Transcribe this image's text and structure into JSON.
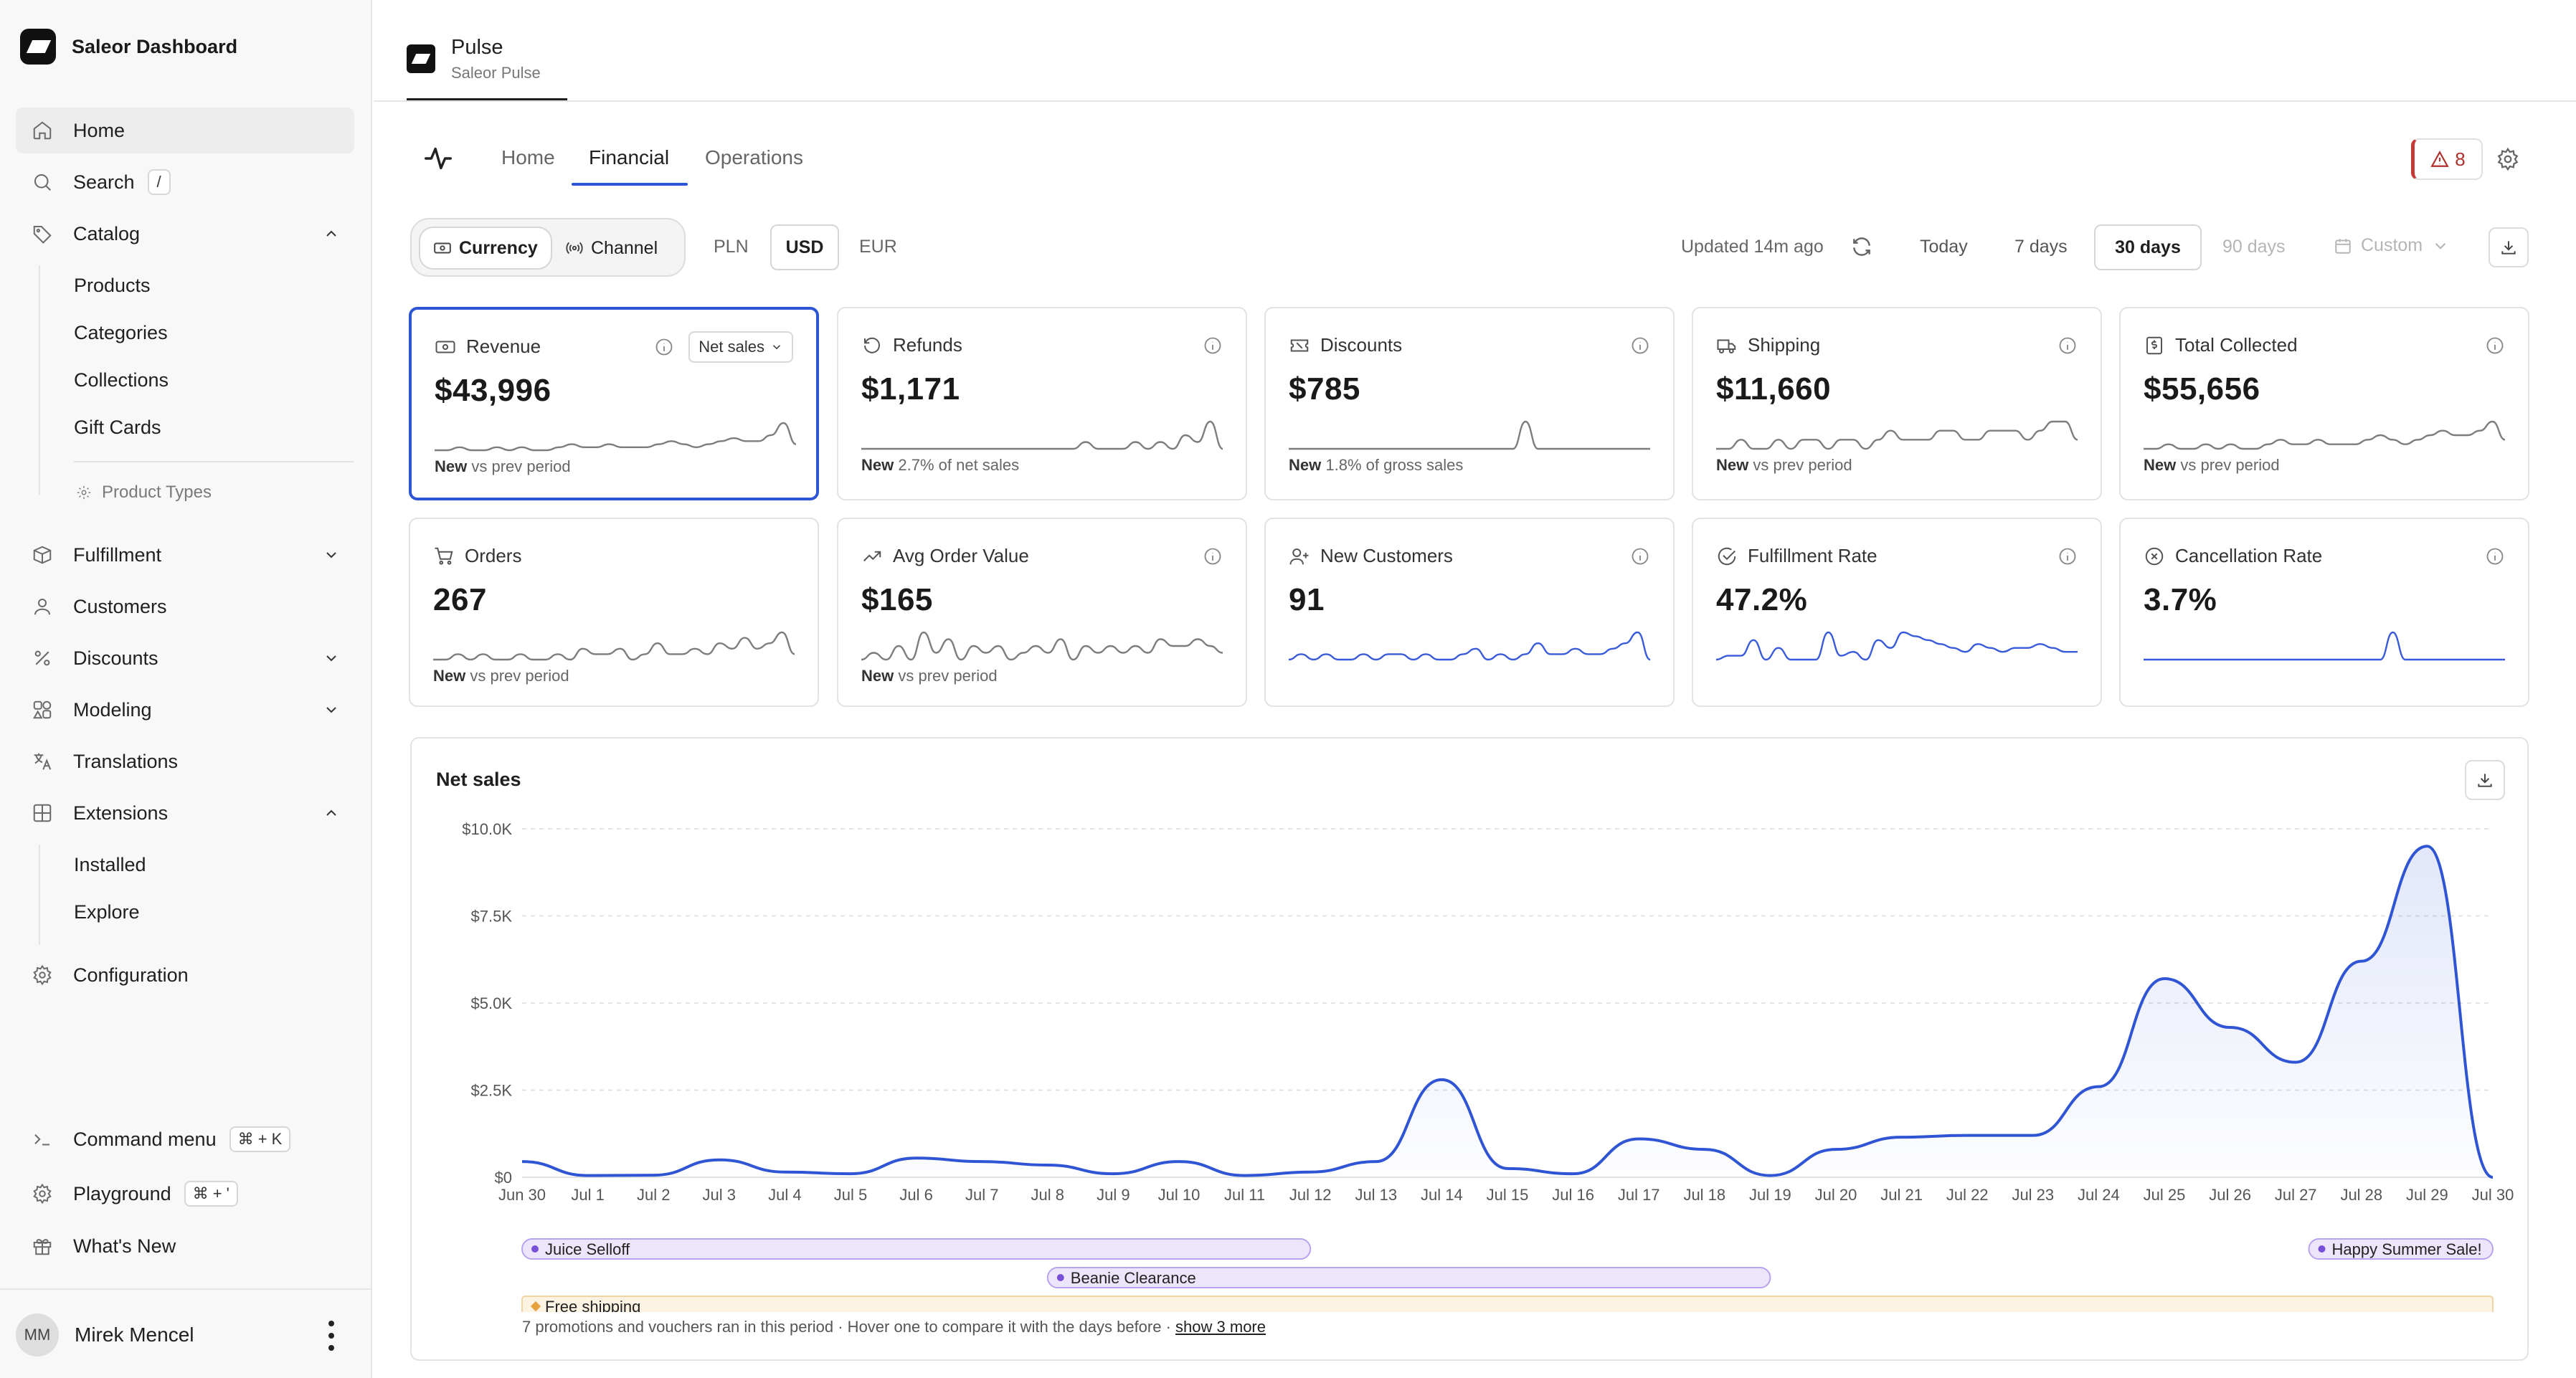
{
  "sidebar": {
    "brand": "Saleor Dashboard",
    "items": [
      {
        "label": "Home"
      },
      {
        "label": "Search",
        "shortcut": "/"
      },
      {
        "label": "Catalog"
      },
      {
        "label": "Fulfillment"
      },
      {
        "label": "Customers"
      },
      {
        "label": "Discounts"
      },
      {
        "label": "Modeling"
      },
      {
        "label": "Translations"
      },
      {
        "label": "Extensions"
      },
      {
        "label": "Configuration"
      }
    ],
    "catalog_sub": [
      "Products",
      "Categories",
      "Collections",
      "Gift Cards"
    ],
    "catalog_muted": "Product Types",
    "extensions_sub": [
      "Installed",
      "Explore"
    ],
    "bottom": [
      {
        "label": "Command menu",
        "shortcut": "⌘ + K"
      },
      {
        "label": "Playground",
        "shortcut": "⌘ + '"
      },
      {
        "label": "What's New"
      }
    ],
    "user": {
      "initials": "MM",
      "name": "Mirek Mencel"
    }
  },
  "app": {
    "title": "Pulse",
    "subtitle": "Saleor Pulse"
  },
  "tabs": [
    "Home",
    "Financial",
    "Operations"
  ],
  "alerts": {
    "count": "8"
  },
  "filters": {
    "group_by": [
      "Currency",
      "Channel"
    ],
    "currencies": [
      "PLN",
      "USD",
      "EUR"
    ],
    "updated": "Updated 14m ago",
    "ranges": [
      "Today",
      "7 days",
      "30 days",
      "90 days"
    ],
    "custom": "Custom"
  },
  "cards": [
    {
      "title": "Revenue",
      "value": "$43,996",
      "badge": "New",
      "foot": "vs prev period",
      "dropdown": "Net sales",
      "spark": [
        3,
        3,
        4,
        3,
        3,
        4,
        3,
        4,
        3,
        3,
        4,
        5,
        4,
        4,
        5,
        4,
        4,
        4,
        5,
        6,
        5,
        4,
        5,
        6,
        7,
        6,
        6,
        8,
        12,
        5
      ],
      "color": "#7d7d7d"
    },
    {
      "title": "Refunds",
      "value": "$1,171",
      "badge": "New",
      "foot": "2.7% of net sales",
      "spark": [
        1,
        1,
        1,
        1,
        1,
        1,
        1,
        1,
        1,
        1,
        1,
        1,
        1,
        1,
        1,
        1,
        1,
        1,
        2,
        1,
        1,
        1,
        2,
        1,
        2,
        1,
        3,
        2,
        5,
        1
      ],
      "color": "#7d7d7d"
    },
    {
      "title": "Discounts",
      "value": "$785",
      "badge": "New",
      "foot": "1.8% of gross sales",
      "spark": [
        1,
        1,
        1,
        1,
        1,
        1,
        1,
        1,
        1,
        1,
        1,
        1,
        1,
        1,
        1,
        1,
        1,
        1,
        1,
        9,
        1,
        1,
        1,
        1,
        1,
        1,
        1,
        1,
        1,
        1
      ],
      "color": "#7d7d7d"
    },
    {
      "title": "Shipping",
      "value": "$11,660",
      "badge": "New",
      "foot": "vs prev period",
      "spark": [
        3,
        3,
        4,
        3,
        3,
        4,
        3,
        4,
        4,
        3,
        4,
        4,
        3,
        4,
        5,
        4,
        4,
        4,
        5,
        5,
        4,
        4,
        5,
        5,
        5,
        4,
        5,
        6,
        6,
        4
      ],
      "color": "#7d7d7d"
    },
    {
      "title": "Total Collected",
      "value": "$55,656",
      "badge": "New",
      "foot": "vs prev period",
      "spark": [
        3,
        3,
        4,
        3,
        3,
        4,
        3,
        4,
        3,
        3,
        4,
        5,
        4,
        4,
        5,
        4,
        4,
        4,
        5,
        6,
        5,
        4,
        5,
        6,
        7,
        6,
        6,
        7,
        9,
        5
      ],
      "color": "#7d7d7d"
    },
    {
      "title": "Orders",
      "value": "267",
      "badge": "New",
      "foot": "vs prev period",
      "spark": [
        3,
        3,
        4,
        3,
        4,
        3,
        3,
        4,
        3,
        3,
        4,
        3,
        5,
        4,
        4,
        5,
        3,
        4,
        6,
        4,
        4,
        5,
        4,
        6,
        5,
        7,
        5,
        6,
        8,
        4
      ],
      "color": "#7d7d7d"
    },
    {
      "title": "Avg Order Value",
      "value": "$165",
      "badge": "New",
      "foot": "vs prev period",
      "spark": [
        4,
        5,
        4,
        6,
        4,
        8,
        5,
        7,
        4,
        6,
        5,
        6,
        4,
        5,
        6,
        5,
        7,
        4,
        6,
        5,
        6,
        5,
        6,
        5,
        7,
        6,
        6,
        7,
        6,
        5
      ],
      "color": "#7d7d7d"
    },
    {
      "title": "New Customers",
      "value": "91",
      "spark": [
        2,
        3,
        2,
        3,
        2,
        2,
        3,
        2,
        3,
        3,
        2,
        3,
        2,
        2,
        3,
        4,
        2,
        3,
        2,
        3,
        5,
        3,
        3,
        4,
        3,
        3,
        4,
        5,
        7,
        2
      ],
      "color": "#3a5bd9"
    },
    {
      "title": "Fulfillment Rate",
      "value": "47.2%",
      "spark": [
        4,
        5,
        5,
        9,
        4,
        7,
        4,
        4,
        4,
        11,
        5,
        6,
        4,
        9,
        7,
        11,
        10,
        9,
        8,
        7,
        6,
        8,
        7,
        6,
        7,
        7,
        8,
        7,
        6,
        6
      ],
      "color": "#3a5bd9"
    },
    {
      "title": "Cancellation Rate",
      "value": "3.7%",
      "spark": [
        1,
        1,
        1,
        1,
        1,
        1,
        1,
        1,
        1,
        1,
        1,
        1,
        1,
        1,
        1,
        1,
        1,
        1,
        1,
        1,
        8,
        1,
        1,
        1,
        1,
        1,
        1,
        1,
        1,
        1
      ],
      "color": "#3a5bd9"
    }
  ],
  "net_sales": {
    "title": "Net sales",
    "promos": [
      {
        "name": "Juice Selloff",
        "start": 0,
        "end": 12,
        "color": "#7a4fd8"
      },
      {
        "name": "Beanie Clearance",
        "start": 8,
        "end": 19,
        "color": "#7a4fd8"
      },
      {
        "name": "Happy Summer Sale!",
        "start": 27.2,
        "end": 30,
        "color": "#7a4fd8"
      },
      {
        "name": "Free shipping",
        "start": 0,
        "end": 30,
        "color": "#e6a23c"
      }
    ],
    "note": "7 promotions and vouchers ran in this period · Hover one to compare it with the days before ·",
    "note_link": "show 3 more"
  },
  "chart_data": {
    "type": "area",
    "title": "Net sales",
    "xlabel": "",
    "ylabel": "",
    "categories": [
      "Jun 30",
      "Jul 1",
      "Jul 2",
      "Jul 3",
      "Jul 4",
      "Jul 5",
      "Jul 6",
      "Jul 7",
      "Jul 8",
      "Jul 9",
      "Jul 10",
      "Jul 11",
      "Jul 12",
      "Jul 13",
      "Jul 14",
      "Jul 15",
      "Jul 16",
      "Jul 17",
      "Jul 18",
      "Jul 19",
      "Jul 20",
      "Jul 21",
      "Jul 22",
      "Jul 23",
      "Jul 24",
      "Jul 25",
      "Jul 26",
      "Jul 27",
      "Jul 28",
      "Jul 29",
      "Jul 30"
    ],
    "values": [
      450,
      50,
      60,
      500,
      150,
      100,
      550,
      450,
      350,
      100,
      450,
      50,
      150,
      450,
      2800,
      250,
      100,
      1100,
      800,
      50,
      800,
      1150,
      1200,
      1200,
      2600,
      5700,
      4300,
      3300,
      6200,
      9500,
      0
    ],
    "yticks": [
      "$0",
      "$2.5K",
      "$5.0K",
      "$7.5K",
      "$10.0K"
    ],
    "ylim": [
      0,
      10000
    ],
    "grid": true,
    "line_color": "#2f55d4"
  }
}
